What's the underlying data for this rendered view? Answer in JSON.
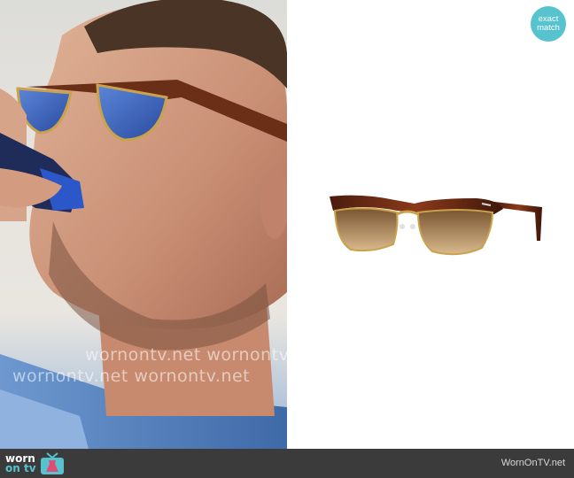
{
  "badge": {
    "line1": "exact",
    "line2": "match",
    "color": "#56c3cf"
  },
  "watermark": {
    "line1": "wornontv.net  wornontv.net",
    "line2": "wornontv.net  wornontv.net"
  },
  "footer": {
    "logo_line1": "worn",
    "logo_line2": "on tv",
    "site": "WornOnTV.net",
    "background": "#3b3b3b"
  },
  "images": {
    "left": "man-drinking-wearing-sunglasses-photo",
    "right": "tortoise-gold-clubmaster-sunglasses-product"
  }
}
